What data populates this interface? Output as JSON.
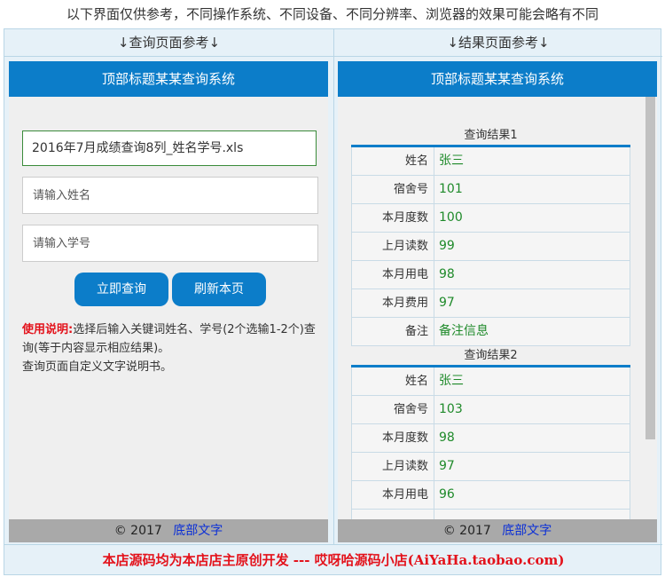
{
  "notice": "以下界面仅供参考，不同操作系统、不同设备、不同分辨率、浏览器的效果可能会略有不同",
  "columns": {
    "left_heading": "↓查询页面参考↓",
    "right_heading": "↓结果页面参考↓"
  },
  "query_page": {
    "header_title": "顶部标题某某查询系统",
    "file_name": "2016年7月成绩查询8列_姓名学号.xls",
    "name_placeholder": "请输入姓名",
    "id_placeholder": "请输入学号",
    "query_button": "立即查询",
    "refresh_button": "刷新本页",
    "usage_label": "使用说明:",
    "usage_text": "选择后输入关键词姓名、学号(2个选输1-2个)查询(等于内容显示相应结果)。",
    "custom_text": "查询页面自定义文字说明书。",
    "footer_copyright": "© 2017",
    "footer_link": "底部文字"
  },
  "result_page": {
    "header_title": "顶部标题某某查询系统",
    "results": [
      {
        "title": "查询结果1",
        "rows": [
          {
            "key": "姓名",
            "value": "张三"
          },
          {
            "key": "宿舍号",
            "value": "101"
          },
          {
            "key": "本月度数",
            "value": "100"
          },
          {
            "key": "上月读数",
            "value": "99"
          },
          {
            "key": "本月用电",
            "value": "98"
          },
          {
            "key": "本月费用",
            "value": "97"
          },
          {
            "key": "备注",
            "value": "备注信息"
          }
        ]
      },
      {
        "title": "查询结果2",
        "rows": [
          {
            "key": "姓名",
            "value": "张三"
          },
          {
            "key": "宿舍号",
            "value": "103"
          },
          {
            "key": "本月度数",
            "value": "98"
          },
          {
            "key": "上月读数",
            "value": "97"
          },
          {
            "key": "本月用电",
            "value": "96"
          },
          {
            "key": "",
            "value": ""
          }
        ]
      }
    ],
    "footer_copyright": "© 2017",
    "footer_link": "底部文字"
  },
  "bottom_note": "本店源码均为本店店主原创开发 --- 哎呀哈源码小店(AiYaHa.taobao.com)",
  "colors": {
    "accent_blue": "#0c7dc9",
    "value_green": "#1f8a2a",
    "alert_red": "#e3121b",
    "footer_gray": "#a9a9a9"
  }
}
